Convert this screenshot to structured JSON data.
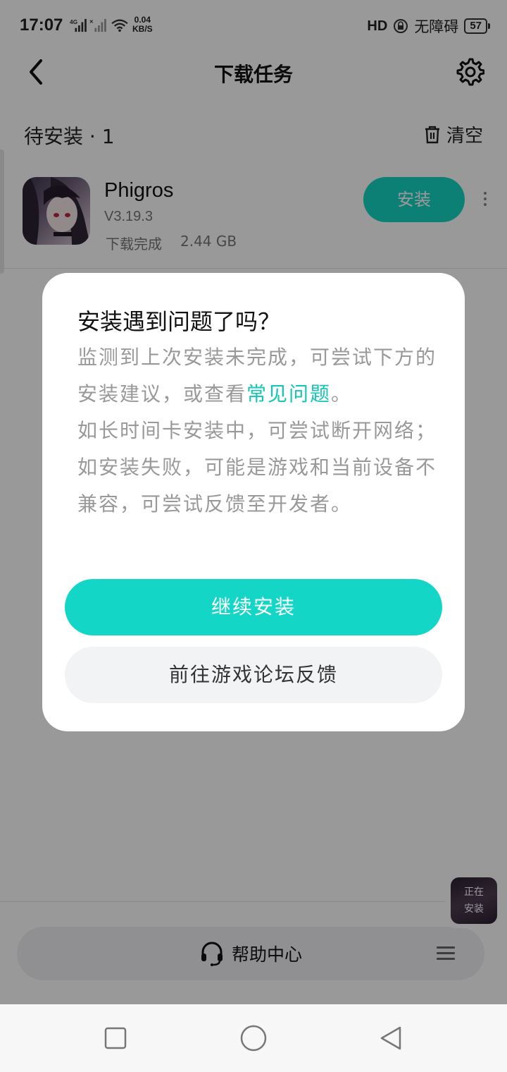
{
  "status_bar": {
    "time": "17:07",
    "network_label": "4G",
    "speed_value": "0.04",
    "speed_unit": "KB/S",
    "hd_label": "HD",
    "accessibility": "无障碍",
    "battery": "57"
  },
  "header": {
    "title": "下载任务",
    "back_icon": "chevron-left-icon",
    "settings_icon": "gear-icon"
  },
  "section": {
    "title": "待安装 · 1",
    "clear_label": "清空",
    "clear_icon": "trash-icon"
  },
  "app": {
    "name": "Phigros",
    "version": "V3.19.3",
    "status": "下载完成",
    "size": "2.44 GB",
    "install_label": "安装"
  },
  "dialog": {
    "title": "安装遇到问题了吗？",
    "body_part1": "监测到上次安装未完成，可尝试下方的安装建议，或查看",
    "faq_link": "常见问题",
    "body_part2": "。",
    "body_line2": "如长时间卡安装中，可尝试断开网络；",
    "body_line3": "如安装失败，可能是游戏和当前设备不兼容，可尝试反馈至开发者。",
    "continue_label": "继续安装",
    "forum_label": "前往游戏论坛反馈"
  },
  "help": {
    "label": "帮助中心",
    "icon": "headset-icon"
  },
  "floating": {
    "line1": "正在",
    "line2": "安装"
  },
  "colors": {
    "accent": "#14d6c6",
    "link": "#13c6b6"
  }
}
